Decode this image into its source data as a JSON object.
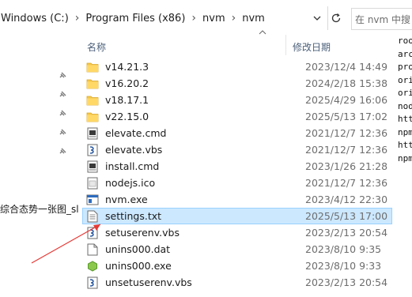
{
  "address": {
    "crumbs": [
      "Windows (C:)",
      "Program Files (x86)",
      "nvm",
      "nvm"
    ]
  },
  "search": {
    "placeholder": "在 nvm 中搜"
  },
  "nav": {
    "clipped_text": "综合态势一张图_sl"
  },
  "columns": {
    "name": "名称",
    "date": "修改日期"
  },
  "files": [
    {
      "name": "v14.21.3",
      "date": "2023/12/4 14:49",
      "icon": "folder-icon"
    },
    {
      "name": "v16.20.2",
      "date": "2024/2/18 15:38",
      "icon": "folder-icon"
    },
    {
      "name": "v18.17.1",
      "date": "2025/4/29 16:06",
      "icon": "folder-icon"
    },
    {
      "name": "v22.15.0",
      "date": "2025/5/13 17:02",
      "icon": "folder-icon"
    },
    {
      "name": "elevate.cmd",
      "date": "2021/12/7 12:36",
      "icon": "cmd-file-icon"
    },
    {
      "name": "elevate.vbs",
      "date": "2021/12/7 12:36",
      "icon": "vbs-file-icon"
    },
    {
      "name": "install.cmd",
      "date": "2023/1/26 21:28",
      "icon": "cmd-file-icon"
    },
    {
      "name": "nodejs.ico",
      "date": "2021/12/7 12:36",
      "icon": "ico-file-icon"
    },
    {
      "name": "nvm.exe",
      "date": "2023/4/12 22:30",
      "icon": "exe-file-icon"
    },
    {
      "name": "settings.txt",
      "date": "2025/5/13 17:00",
      "icon": "txt-file-icon",
      "selected": true
    },
    {
      "name": "setuserenv.vbs",
      "date": "2023/2/13 20:54",
      "icon": "vbs-file-icon"
    },
    {
      "name": "unins000.dat",
      "date": "2023/8/10 9:35",
      "icon": "dat-file-icon"
    },
    {
      "name": "unins000.exe",
      "date": "2023/8/10 9:33",
      "icon": "setup-exe-icon"
    },
    {
      "name": "unsetuserenv.vbs",
      "date": "2023/2/13 20:54",
      "icon": "vbs-file-icon"
    }
  ],
  "preview_lines": [
    "roo",
    "arc",
    "pro",
    "ori",
    "ori",
    "nod",
    "htt",
    "npm",
    "htt",
    "npm"
  ],
  "colors": {
    "selection_bg": "#cce8ff",
    "selection_border": "#99d1ff",
    "folder": "#f5c84c",
    "annotation_arrow": "#e53935"
  }
}
